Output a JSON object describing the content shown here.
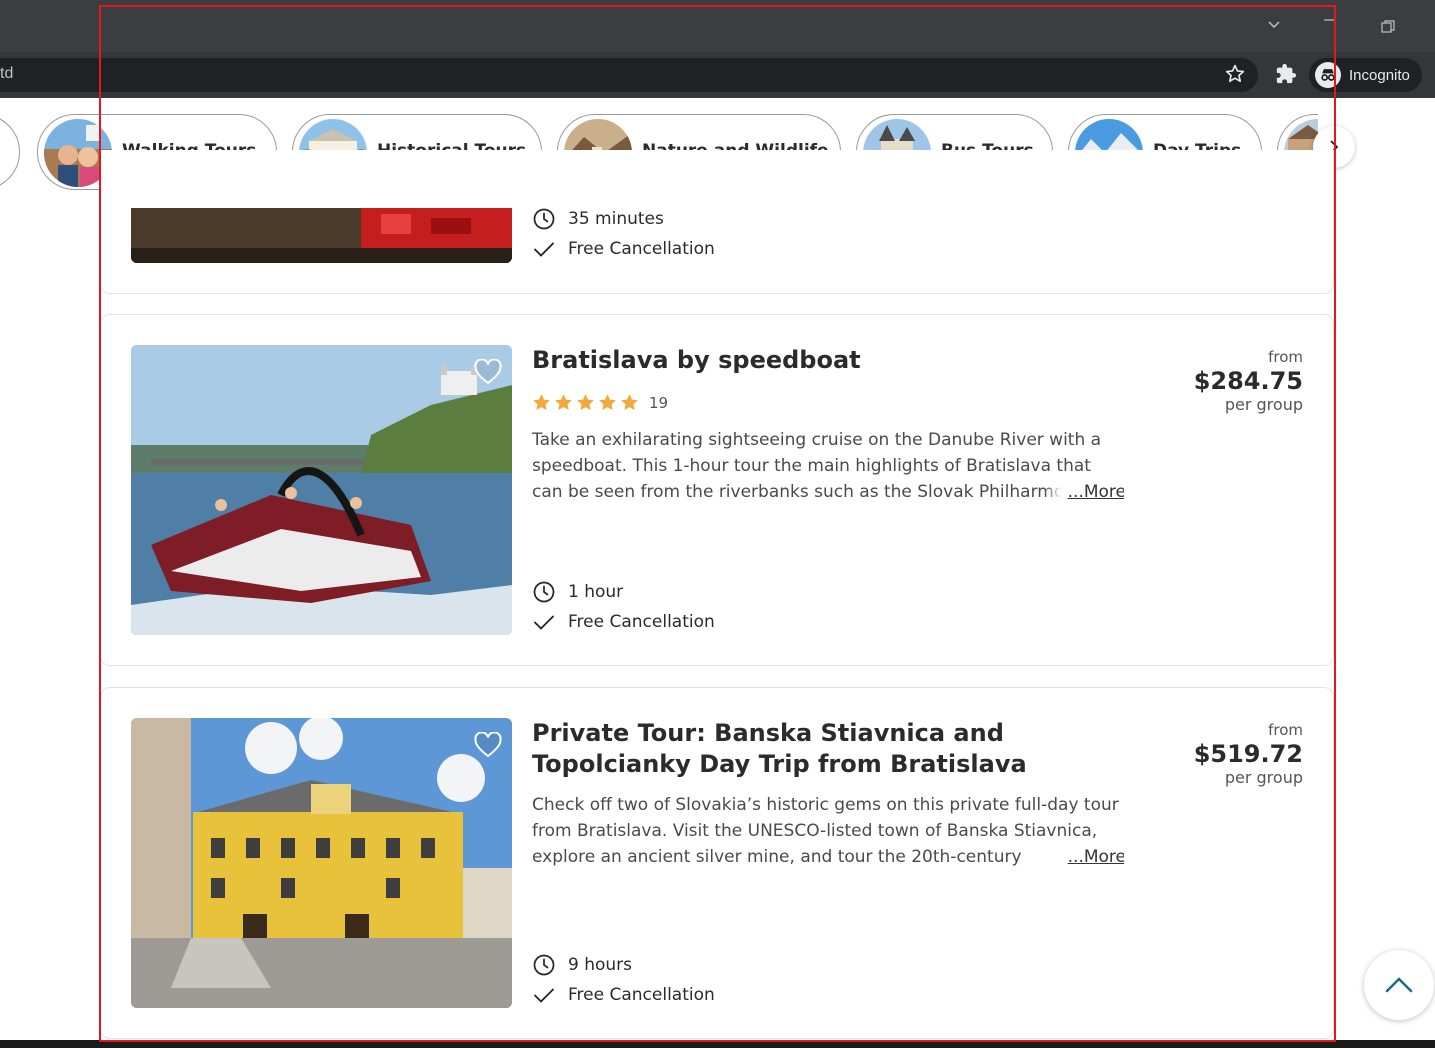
{
  "browser": {
    "url_fragment": "td",
    "incognito_label": "Incognito",
    "icons": [
      "chevron-down-icon",
      "minimize-icon",
      "restore-icon",
      "star-icon",
      "puzzle-icon",
      "incognito-icon"
    ]
  },
  "categories": [
    {
      "label": "Walking Tours"
    },
    {
      "label": "Historical Tours"
    },
    {
      "label": "Nature and Wildlife"
    },
    {
      "label": "Bus Tours"
    },
    {
      "label": "Day Trips"
    }
  ],
  "tours": [
    {
      "duration": "35 minutes",
      "cancellation": "Free Cancellation"
    },
    {
      "title": "Bratislava by speedboat",
      "rating_stars": 5,
      "review_count": "19",
      "description": "Take an exhilarating sightseeing cruise on the Danube River with a speedboat. This 1-hour tour the main highlights of Bratislava that can be seen from the riverbanks such as the Slovak Philharmonic",
      "more_label": "...More",
      "duration": "1 hour",
      "cancellation": "Free Cancellation",
      "price_from": "from",
      "price": "$284.75",
      "price_unit": "per group"
    },
    {
      "title": "Private Tour: Banska Stiavnica and Topolcianky Day Trip from Bratislava",
      "description": "Check off two of Slovakia’s historic gems on this private full-day tour from Bratislava. Visit the UNESCO-listed town of Banska Stiavnica, explore an ancient silver mine, and tour the 20th-century",
      "more_label": "...More",
      "duration": "9 hours",
      "cancellation": "Free Cancellation",
      "price_from": "from",
      "price": "$519.72",
      "price_unit": "per group"
    }
  ],
  "colors": {
    "star": "#f2a93b",
    "outline": "#e0191f",
    "accent": "#1a6e7e"
  }
}
